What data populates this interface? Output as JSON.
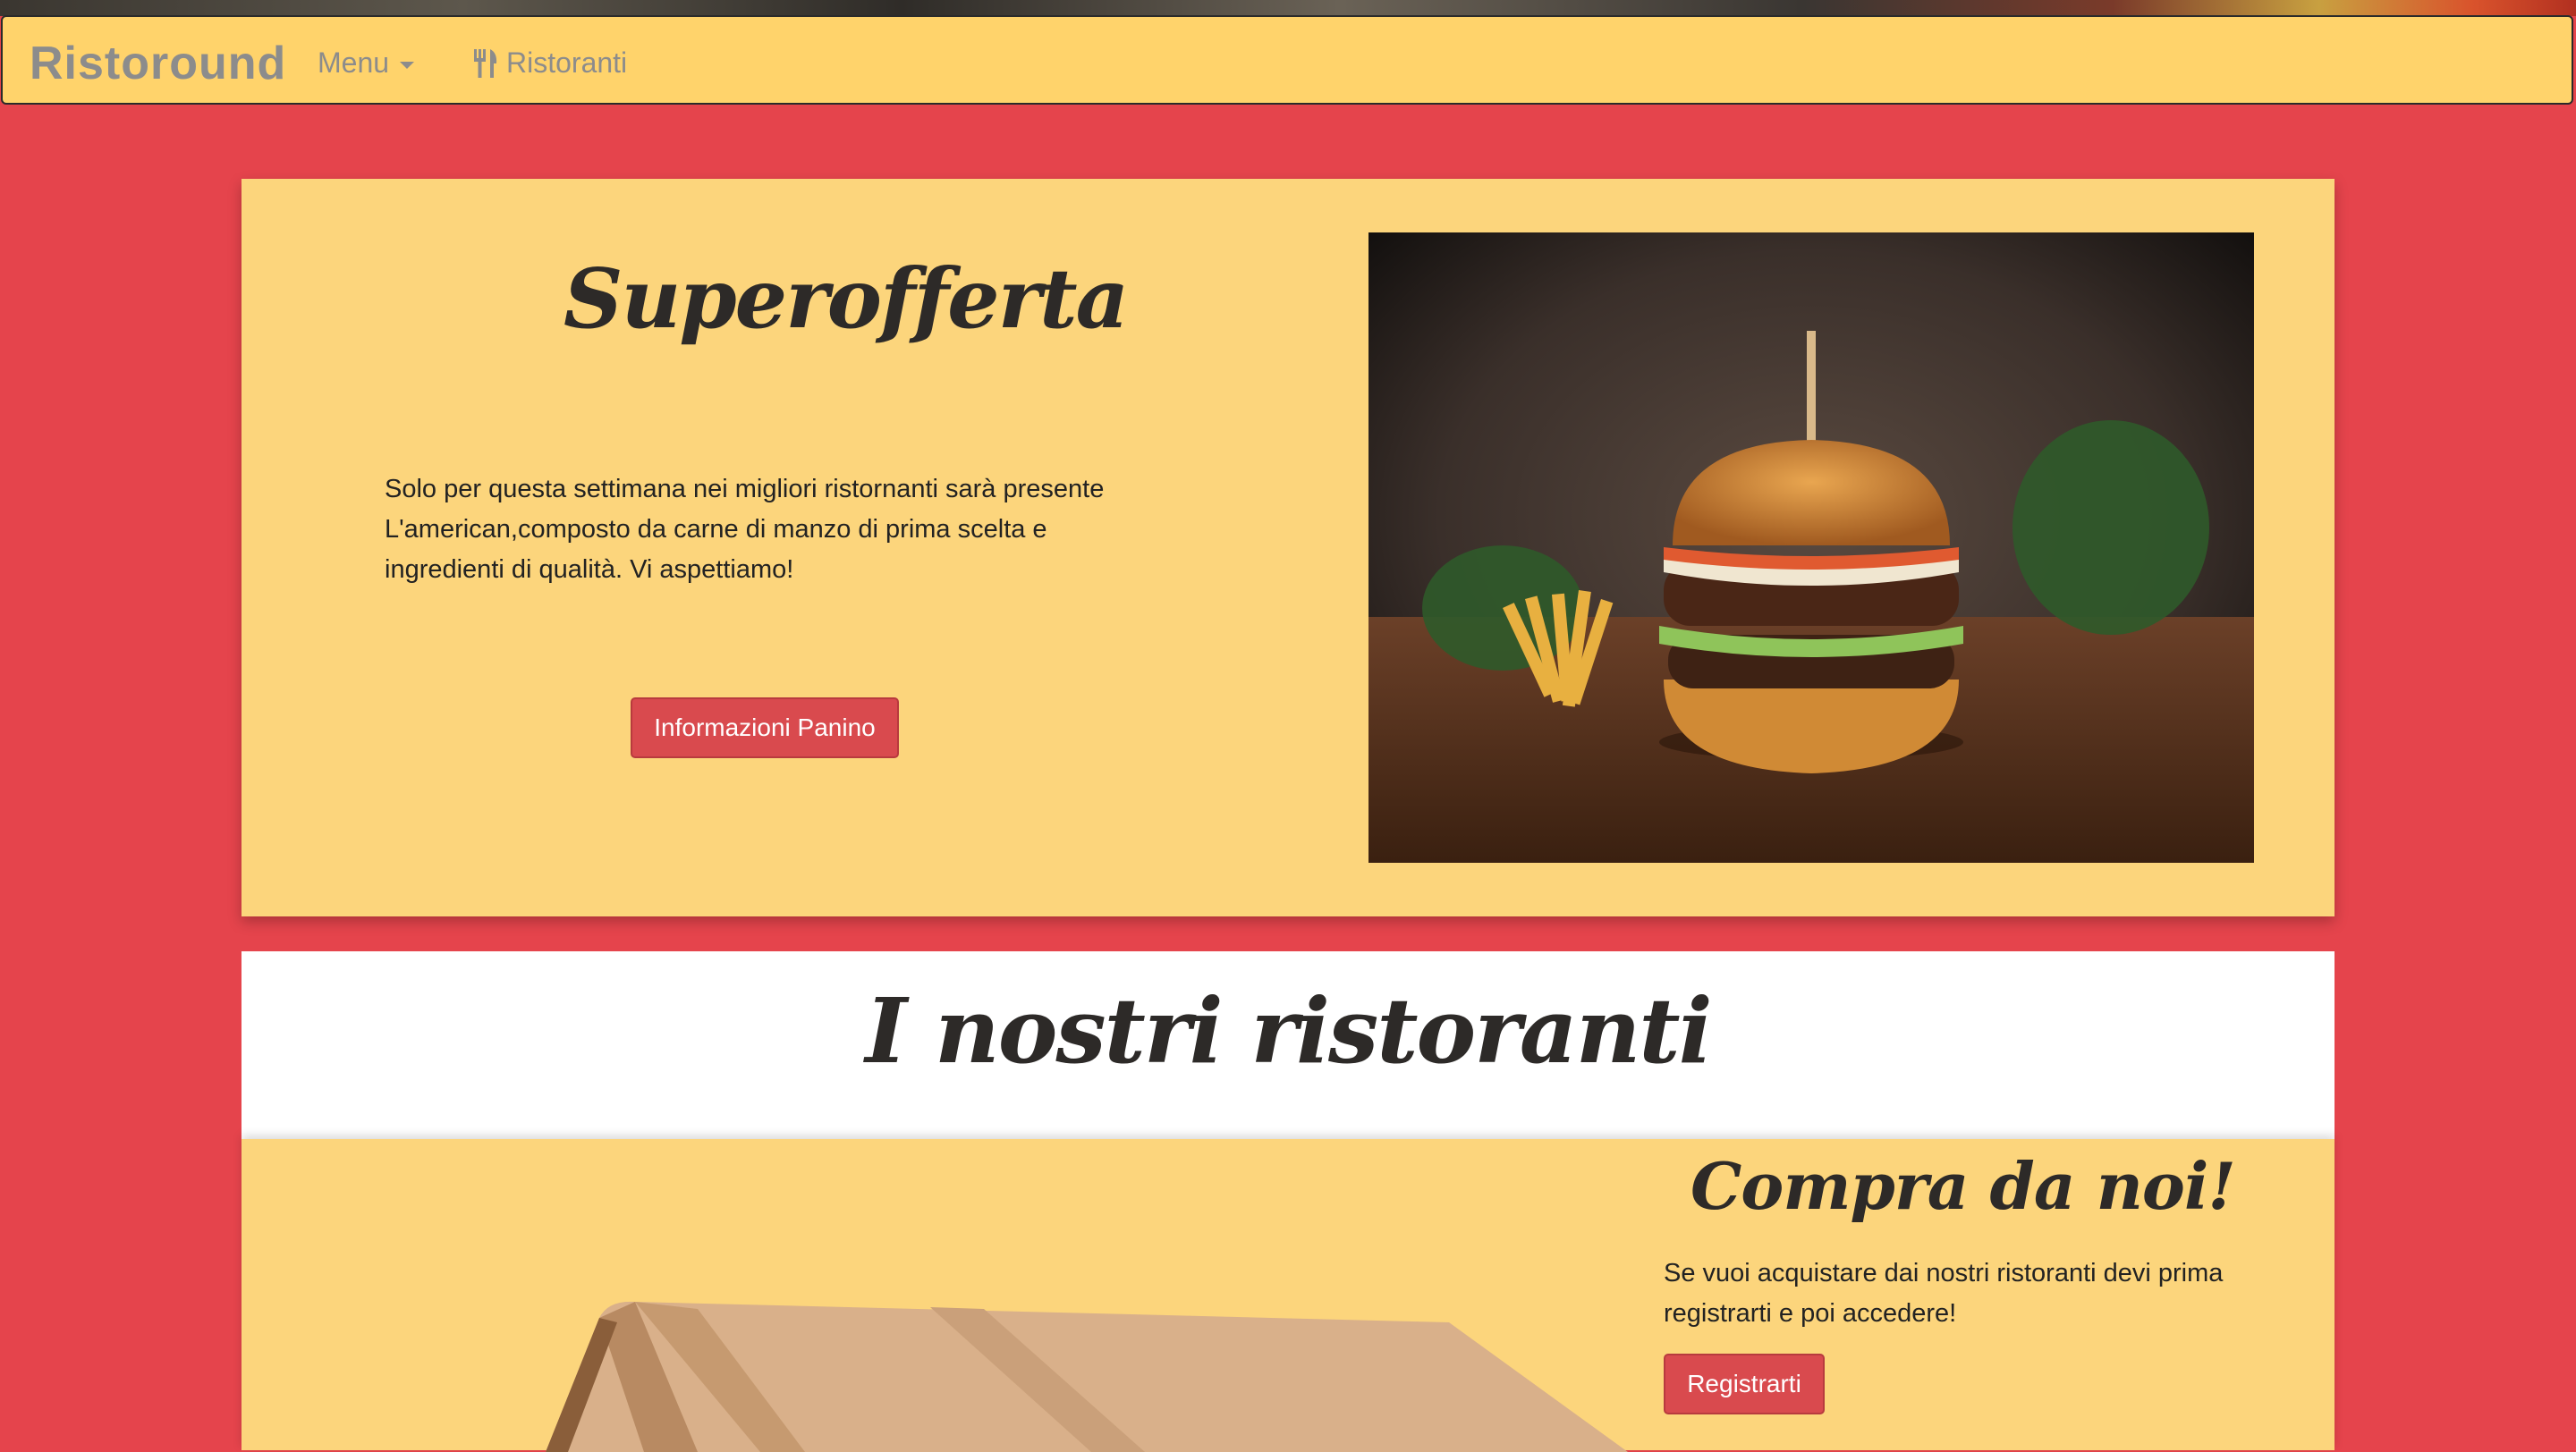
{
  "navbar": {
    "brand": "Ristoround",
    "menu_label": "Menu",
    "ristoranti_label": "Ristoranti"
  },
  "offer": {
    "title": "Superofferta",
    "text": "Solo per questa settimana nei migliori ristornanti sarà presente L'american,composto da carne di manzo di prima scelta e ingredienti di qualità. Vi aspettiamo!",
    "button_label": "Informazioni Panino"
  },
  "restaurants": {
    "title": "I nostri ristoranti"
  },
  "buy": {
    "title": "Compra da noi!",
    "text": "Se vuoi acquistare dai nostri ristoranti devi prima registrarti e poi accedere!",
    "button_label": "Registrarti"
  },
  "colors": {
    "background": "#e5444c",
    "panel": "#fcd57c",
    "navbar": "#ffd36b",
    "button": "#d94a4e"
  },
  "icons": {
    "ristoranti_icon": "cutlery-icon",
    "menu_caret": "caret-down-icon"
  }
}
